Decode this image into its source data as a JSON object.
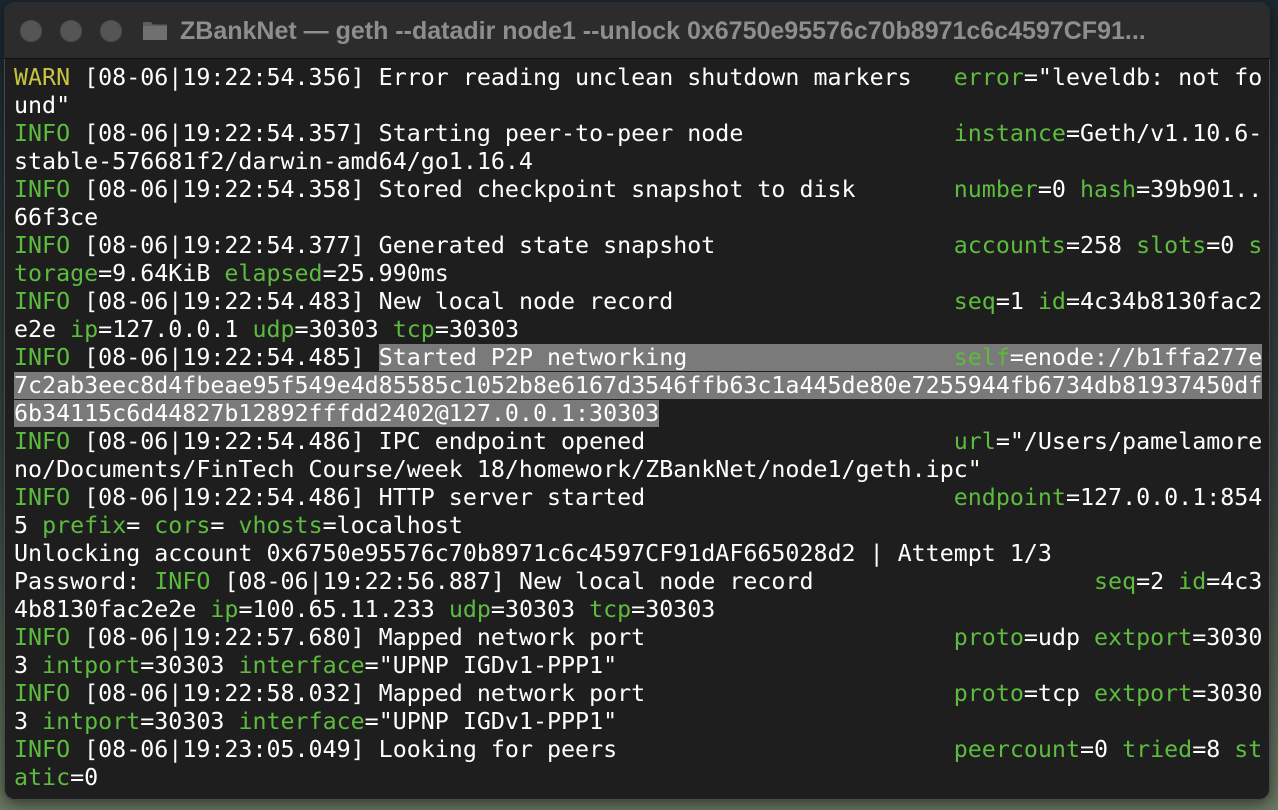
{
  "window": {
    "title": "ZBankNet — geth --datadir node1 --unlock 0x6750e95576c70b8971c6c4597CF91..."
  },
  "terminal": {
    "lines": [
      [
        {
          "t": "WARN",
          "c": "warn"
        },
        {
          "t": " [08-06|19:22:54.356] Error reading unclean shutdown markers   "
        },
        {
          "t": "error",
          "c": "key"
        },
        {
          "t": "=\"leveldb: not fo"
        }
      ],
      [
        {
          "t": "und\""
        }
      ],
      [
        {
          "t": "INFO",
          "c": "info"
        },
        {
          "t": " [08-06|19:22:54.357] Starting peer-to-peer node               "
        },
        {
          "t": "instance",
          "c": "key"
        },
        {
          "t": "=Geth/v1.10.6-"
        }
      ],
      [
        {
          "t": "stable-576681f2/darwin-amd64/go1.16.4"
        }
      ],
      [
        {
          "t": "INFO",
          "c": "info"
        },
        {
          "t": " [08-06|19:22:54.358] Stored checkpoint snapshot to disk       "
        },
        {
          "t": "number",
          "c": "key"
        },
        {
          "t": "=0 "
        },
        {
          "t": "hash",
          "c": "key"
        },
        {
          "t": "=39b901.."
        }
      ],
      [
        {
          "t": "66f3ce"
        }
      ],
      [
        {
          "t": "INFO",
          "c": "info"
        },
        {
          "t": " [08-06|19:22:54.377] Generated state snapshot                 "
        },
        {
          "t": "accounts",
          "c": "key"
        },
        {
          "t": "=258 "
        },
        {
          "t": "slots",
          "c": "key"
        },
        {
          "t": "=0 "
        },
        {
          "t": "s",
          "c": "key"
        }
      ],
      [
        {
          "t": "torage",
          "c": "key"
        },
        {
          "t": "=9.64KiB "
        },
        {
          "t": "elapsed",
          "c": "key"
        },
        {
          "t": "=25.990ms"
        }
      ],
      [
        {
          "t": "INFO",
          "c": "info"
        },
        {
          "t": " [08-06|19:22:54.483] New local node record                    "
        },
        {
          "t": "seq",
          "c": "key"
        },
        {
          "t": "=1 "
        },
        {
          "t": "id",
          "c": "key"
        },
        {
          "t": "=4c34b8130fac2"
        }
      ],
      [
        {
          "t": "e2e "
        },
        {
          "t": "ip",
          "c": "key"
        },
        {
          "t": "=127.0.0.1 "
        },
        {
          "t": "udp",
          "c": "key"
        },
        {
          "t": "=30303 "
        },
        {
          "t": "tcp",
          "c": "key"
        },
        {
          "t": "=30303"
        }
      ],
      [
        {
          "t": "INFO",
          "c": "info"
        },
        {
          "t": " [08-06|19:22:54.485] "
        },
        {
          "t": "Started P2P networking                   ",
          "c": "sel"
        },
        {
          "t": "self",
          "c": "key sel"
        },
        {
          "t": "=enode://b1ffa277e",
          "c": "sel"
        }
      ],
      [
        {
          "t": "7c2ab3eec8d4fbeae95f549e4d85585c1052b8e6167d3546ffb63c1a445de80e7255944fb6734db81937450df",
          "c": "sel"
        }
      ],
      [
        {
          "t": "6b34115c6d44827b12892fffdd2402@127.0.0.1:30303",
          "c": "sel"
        }
      ],
      [
        {
          "t": "INFO",
          "c": "info"
        },
        {
          "t": " [08-06|19:22:54.486] IPC endpoint opened                      "
        },
        {
          "t": "url",
          "c": "key"
        },
        {
          "t": "=\"/Users/pamelamore"
        }
      ],
      [
        {
          "t": "no/Documents/FinTech Course/week 18/homework/ZBankNet/node1/geth.ipc\""
        }
      ],
      [
        {
          "t": "INFO",
          "c": "info"
        },
        {
          "t": " [08-06|19:22:54.486] HTTP server started                      "
        },
        {
          "t": "endpoint",
          "c": "key"
        },
        {
          "t": "=127.0.0.1:854"
        }
      ],
      [
        {
          "t": "5 "
        },
        {
          "t": "prefix",
          "c": "key"
        },
        {
          "t": "= "
        },
        {
          "t": "cors",
          "c": "key"
        },
        {
          "t": "= "
        },
        {
          "t": "vhosts",
          "c": "key"
        },
        {
          "t": "=localhost"
        }
      ],
      [
        {
          "t": "Unlocking account 0x6750e95576c70b8971c6c4597CF91dAF665028d2 | Attempt 1/3"
        }
      ],
      [
        {
          "t": "Password: "
        },
        {
          "t": "INFO",
          "c": "info"
        },
        {
          "t": " [08-06|19:22:56.887] New local node record                    "
        },
        {
          "t": "seq",
          "c": "key"
        },
        {
          "t": "=2 "
        },
        {
          "t": "id",
          "c": "key"
        },
        {
          "t": "=4c3"
        }
      ],
      [
        {
          "t": "4b8130fac2e2e "
        },
        {
          "t": "ip",
          "c": "key"
        },
        {
          "t": "=100.65.11.233 "
        },
        {
          "t": "udp",
          "c": "key"
        },
        {
          "t": "=30303 "
        },
        {
          "t": "tcp",
          "c": "key"
        },
        {
          "t": "=30303"
        }
      ],
      [
        {
          "t": "INFO",
          "c": "info"
        },
        {
          "t": " [08-06|19:22:57.680] Mapped network port                      "
        },
        {
          "t": "proto",
          "c": "key"
        },
        {
          "t": "=udp "
        },
        {
          "t": "extport",
          "c": "key"
        },
        {
          "t": "=3030"
        }
      ],
      [
        {
          "t": "3 "
        },
        {
          "t": "intport",
          "c": "key"
        },
        {
          "t": "=30303 "
        },
        {
          "t": "interface",
          "c": "key"
        },
        {
          "t": "=\"UPNP IGDv1-PPP1\""
        }
      ],
      [
        {
          "t": "INFO",
          "c": "info"
        },
        {
          "t": " [08-06|19:22:58.032] Mapped network port                      "
        },
        {
          "t": "proto",
          "c": "key"
        },
        {
          "t": "=tcp "
        },
        {
          "t": "extport",
          "c": "key"
        },
        {
          "t": "=3030"
        }
      ],
      [
        {
          "t": "3 "
        },
        {
          "t": "intport",
          "c": "key"
        },
        {
          "t": "=30303 "
        },
        {
          "t": "interface",
          "c": "key"
        },
        {
          "t": "=\"UPNP IGDv1-PPP1\""
        }
      ],
      [
        {
          "t": "INFO",
          "c": "info"
        },
        {
          "t": " [08-06|19:23:05.049] Looking for peers                        "
        },
        {
          "t": "peercount",
          "c": "key"
        },
        {
          "t": "=0 "
        },
        {
          "t": "tried",
          "c": "key"
        },
        {
          "t": "=8 "
        },
        {
          "t": "st",
          "c": "key"
        }
      ],
      [
        {
          "t": "atic",
          "c": "key"
        },
        {
          "t": "=0"
        }
      ]
    ]
  },
  "colors": {
    "background": "#1e1e1e",
    "text": "#ffffff",
    "warn": "#c7c440",
    "info_and_keys": "#5dbb3f",
    "selection": "#7a7a7a"
  },
  "icons": {
    "folder": "folder-icon",
    "close": "close-button",
    "minimize": "minimize-button",
    "zoom": "zoom-button"
  }
}
